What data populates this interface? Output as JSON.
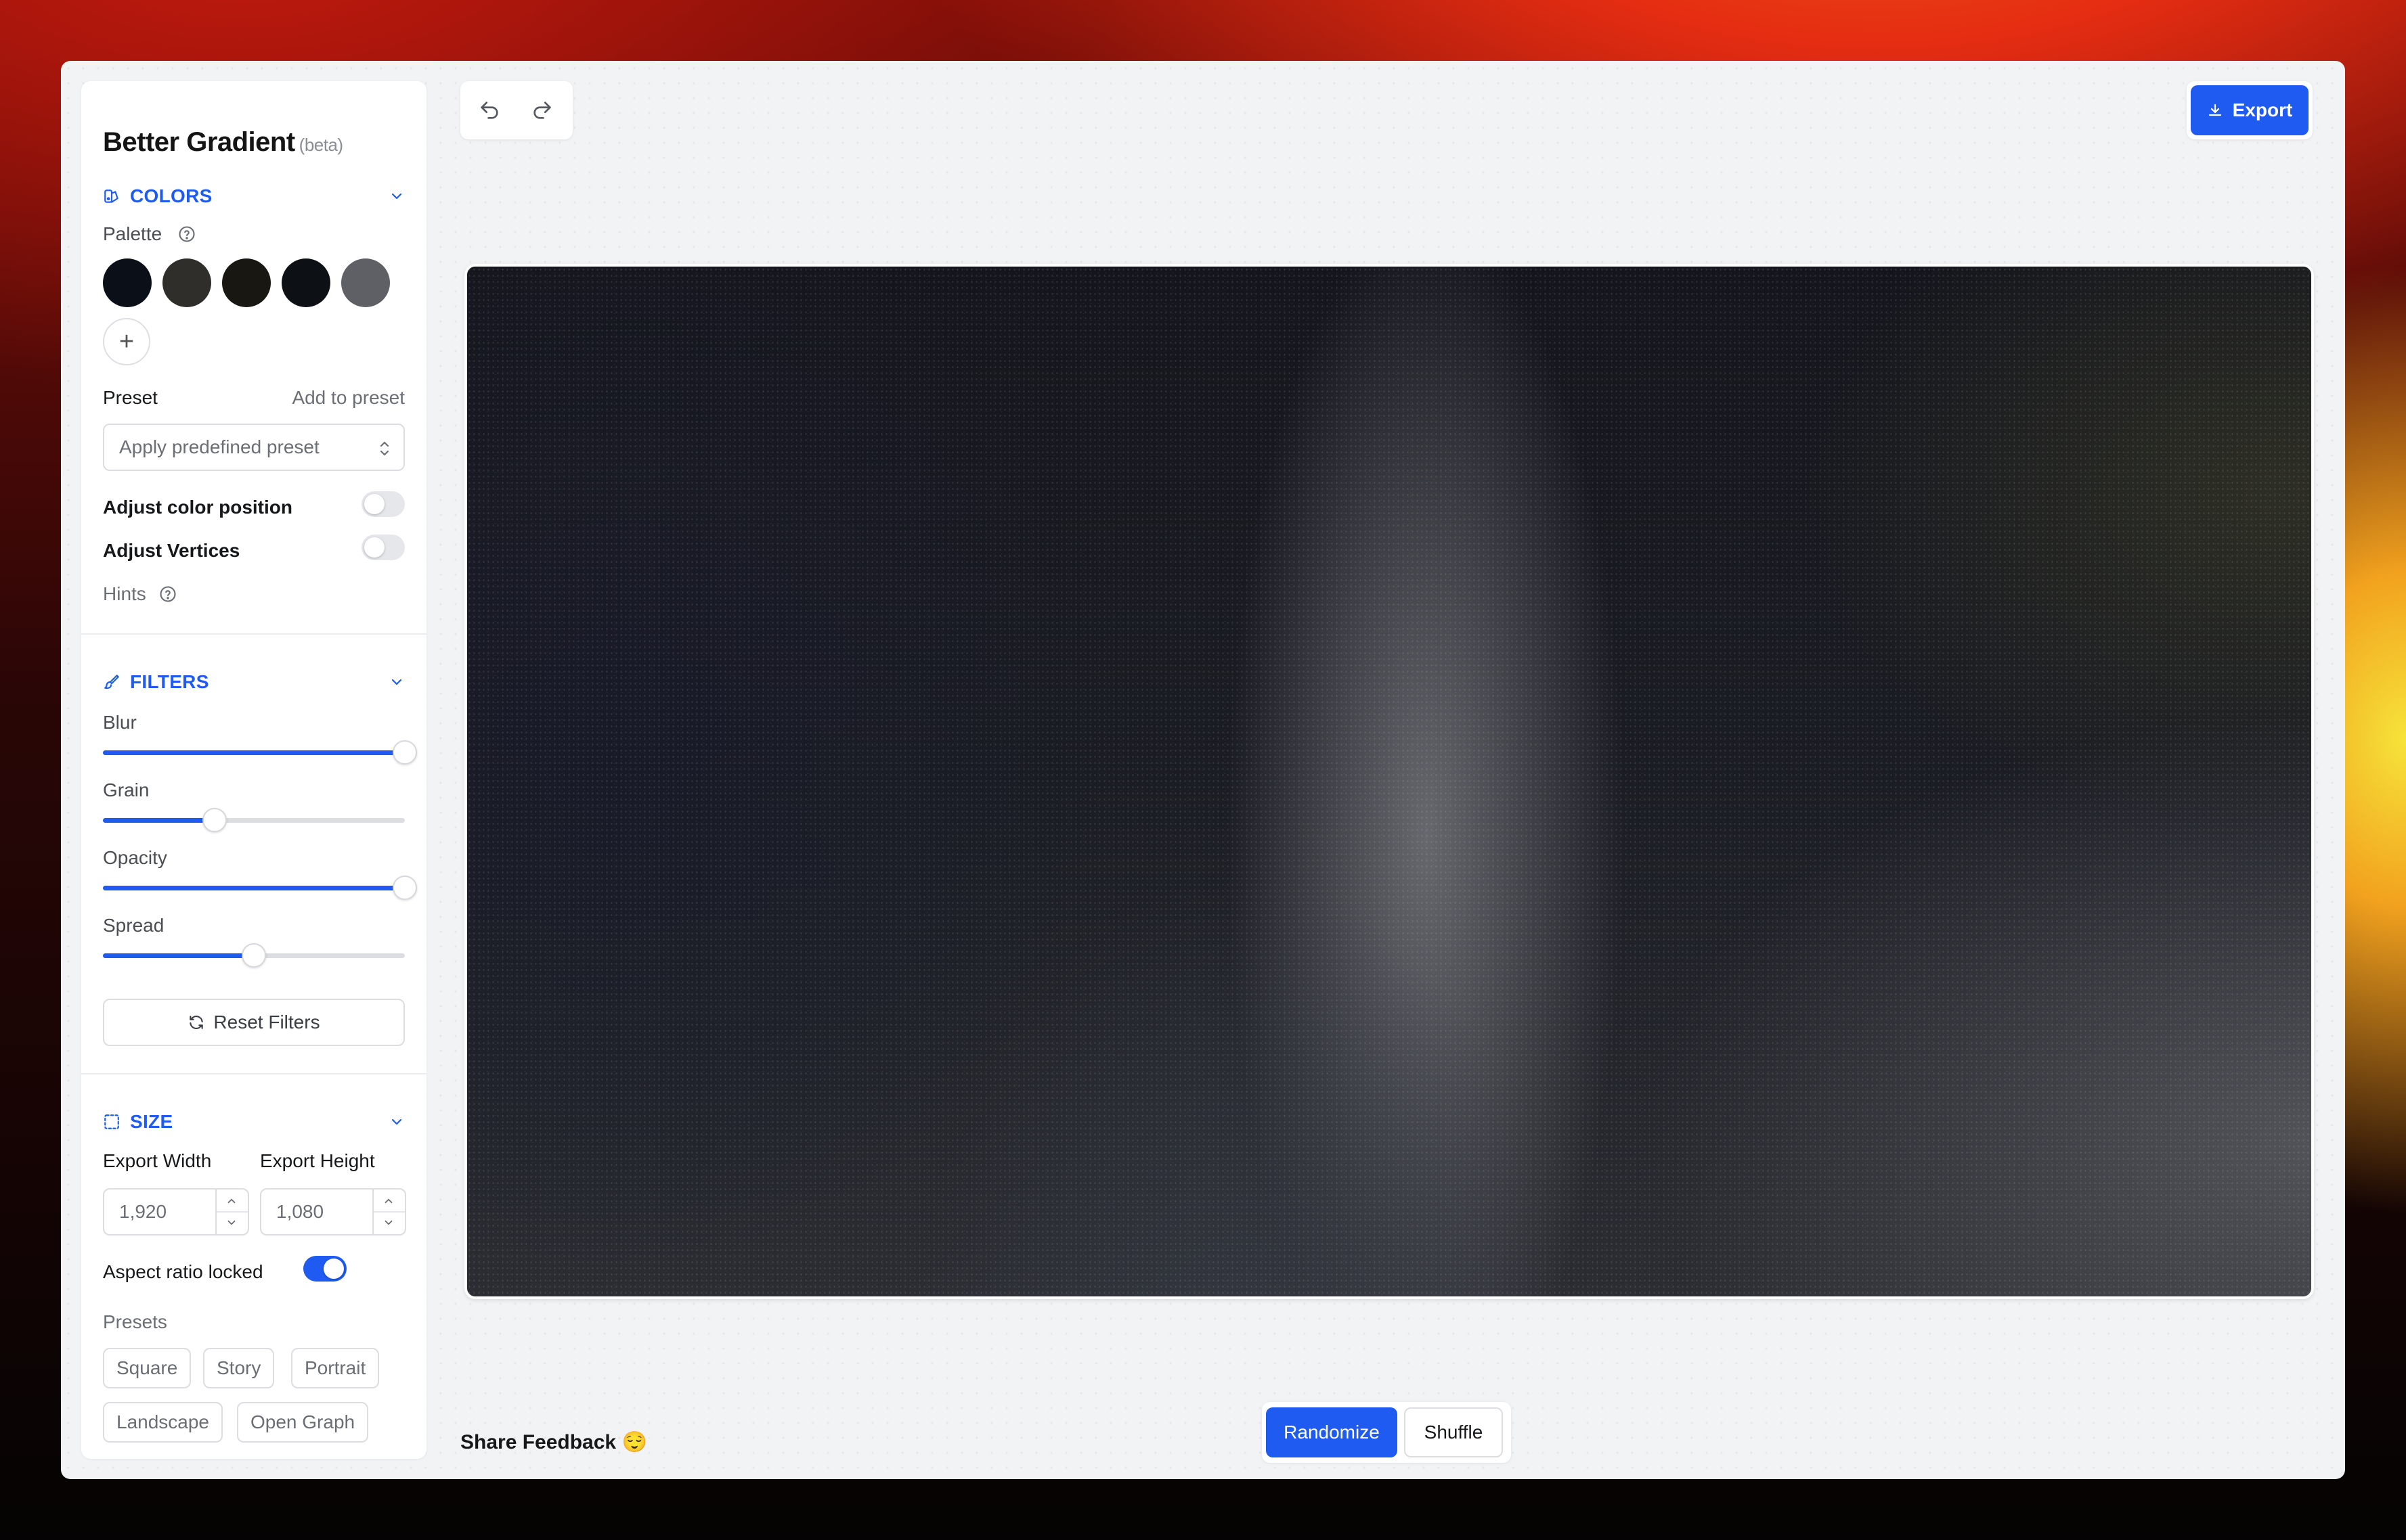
{
  "app": {
    "title": "Better Gradient",
    "badge": "(beta)"
  },
  "colors": {
    "section_label": "COLORS",
    "palette_label": "Palette",
    "swatches": [
      "#0b0f18",
      "#302e2b",
      "#181711",
      "#0d1116",
      "#5f6065"
    ],
    "add_label": "+",
    "preset_label": "Preset",
    "add_to_preset": "Add to preset",
    "preset_placeholder": "Apply predefined preset",
    "adjust_position_label": "Adjust color position",
    "adjust_position_on": false,
    "adjust_vertices_label": "Adjust Vertices",
    "adjust_vertices_on": false,
    "hints_label": "Hints"
  },
  "filters": {
    "section_label": "FILTERS",
    "sliders": [
      {
        "label": "Blur",
        "value": 1.0
      },
      {
        "label": "Grain",
        "value": 0.37
      },
      {
        "label": "Opacity",
        "value": 1.0
      },
      {
        "label": "Spread",
        "value": 0.5
      }
    ],
    "reset_label": "Reset Filters"
  },
  "size": {
    "section_label": "SIZE",
    "width_label": "Export Width",
    "height_label": "Export Height",
    "width_value": "1,920",
    "height_value": "1,080",
    "aspect_label": "Aspect ratio locked",
    "aspect_on": true,
    "presets_label": "Presets",
    "presets": [
      "Square",
      "Story",
      "Portrait",
      "Landscape",
      "Open Graph"
    ]
  },
  "toolbar": {
    "undo_icon": "undo-icon",
    "redo_icon": "redo-icon",
    "export_label": "Export"
  },
  "footer": {
    "feedback_label": "Share Feedback 😌",
    "randomize_label": "Randomize",
    "shuffle_label": "Shuffle"
  },
  "accent": "#1f5bf0"
}
